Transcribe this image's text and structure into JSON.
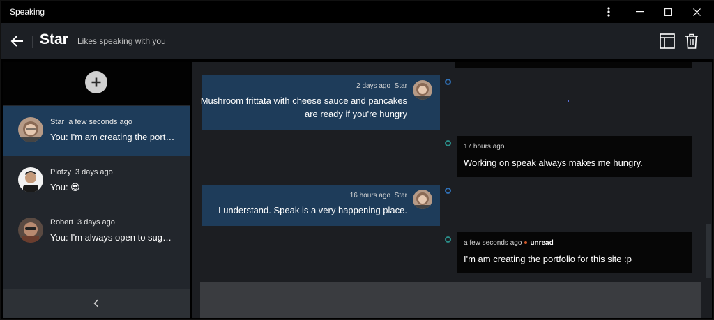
{
  "window": {
    "title": "Speaking",
    "controls": [
      "more-icon",
      "minimize-icon",
      "maximize-icon",
      "close-icon"
    ]
  },
  "header": {
    "title": "Star",
    "subtitle": "Likes speaking with you",
    "icons": [
      "back-arrow-icon",
      "layout-panel-icon",
      "trash-icon"
    ]
  },
  "sidebar": {
    "add_icon": "plus-icon",
    "contacts": [
      {
        "name": "Star",
        "time": "a few seconds ago",
        "message": "You: I'm am creating the portfolio for this site :p",
        "active": true
      },
      {
        "name": "Plotzy",
        "time": "3 days ago",
        "message": "You: 😎",
        "active": false
      },
      {
        "name": "Robert",
        "time": "3 days ago",
        "message": "You: I'm always open to suggestions",
        "active": false
      }
    ],
    "collapse_icon": "chevron-left-icon"
  },
  "messages": [
    {
      "side": "mine",
      "time": "2 days ago",
      "author": "Star",
      "text_line1": "Mushroom frittata with cheese sauce and pancakes",
      "text_line2": "are ready if you're hungry"
    },
    {
      "side": "theirs",
      "time": "17 hours ago",
      "text": "Working on speak always makes me hungry."
    },
    {
      "side": "mine",
      "time": "16 hours ago",
      "author": "Star",
      "text": "I understand. Speak is a very happening place."
    },
    {
      "side": "theirs",
      "time": "a few seconds ago",
      "status": "unread",
      "text": "I'm am creating the portfolio for this site :p"
    }
  ],
  "colors": {
    "accent_bubble": "#1e3c5a",
    "dark_bubble": "#060606",
    "timeline_dot_blue": "#2f6fb5",
    "timeline_dot_teal": "#2a8f8a",
    "unread_dot": "#d0582a"
  }
}
